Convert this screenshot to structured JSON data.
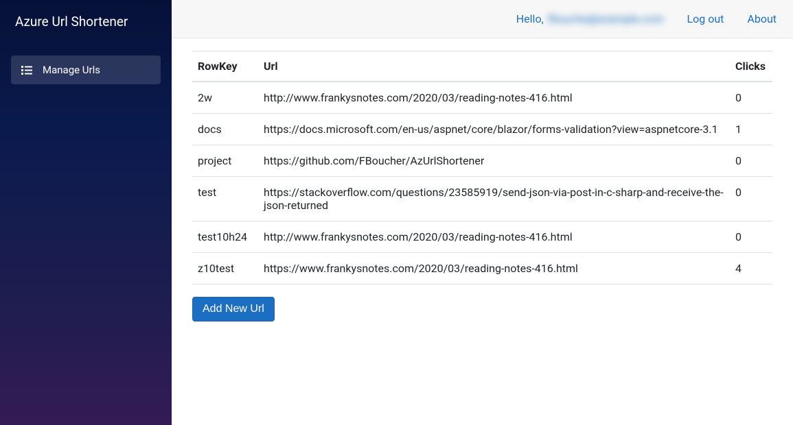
{
  "sidebar": {
    "brand": "Azure Url Shortener",
    "items": [
      {
        "label": "Manage Urls"
      }
    ]
  },
  "topbar": {
    "greeting_prefix": "Hello,",
    "greeting_user": "fbouche@example.com",
    "logout": "Log out",
    "about": "About"
  },
  "table": {
    "headers": {
      "rowkey": "RowKey",
      "url": "Url",
      "clicks": "Clicks"
    },
    "rows": [
      {
        "rowkey": "2w",
        "url": "http://www.frankysnotes.com/2020/03/reading-notes-416.html",
        "clicks": "0"
      },
      {
        "rowkey": "docs",
        "url": "https://docs.microsoft.com/en-us/aspnet/core/blazor/forms-validation?view=aspnetcore-3.1",
        "clicks": "1"
      },
      {
        "rowkey": "project",
        "url": "https://github.com/FBoucher/AzUrlShortener",
        "clicks": "0"
      },
      {
        "rowkey": "test",
        "url": "https://stackoverflow.com/questions/23585919/send-json-via-post-in-c-sharp-and-receive-the-json-returned",
        "clicks": "0"
      },
      {
        "rowkey": "test10h24",
        "url": "http://www.frankysnotes.com/2020/03/reading-notes-416.html",
        "clicks": "0"
      },
      {
        "rowkey": "z10test",
        "url": "https://www.frankysnotes.com/2020/03/reading-notes-416.html",
        "clicks": "4"
      }
    ]
  },
  "actions": {
    "add_new": "Add New Url"
  }
}
